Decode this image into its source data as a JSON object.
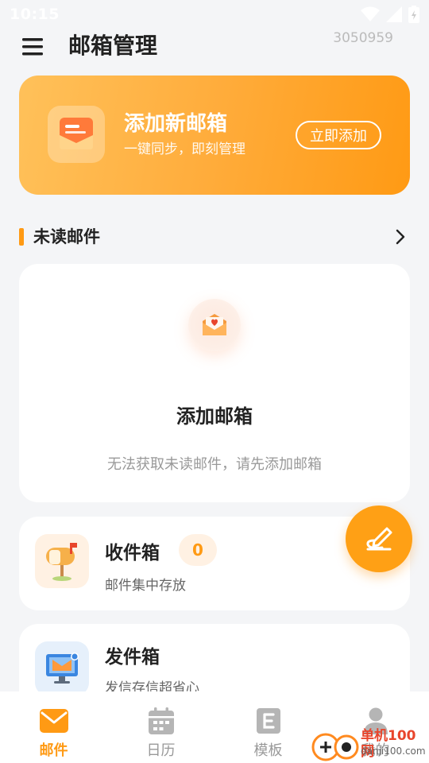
{
  "status_bar": {
    "time": "10:15"
  },
  "header": {
    "title": "邮箱管理",
    "code": "3050959"
  },
  "banner": {
    "title": "添加新邮箱",
    "subtitle": "一键同步，即刻管理",
    "button": "立即添加"
  },
  "unread_section": {
    "title": "未读邮件"
  },
  "empty_state": {
    "title": "添加邮箱",
    "description": "无法获取未读邮件，请先添加邮箱"
  },
  "inbox": {
    "title": "收件箱",
    "count": "0",
    "subtitle": "邮件集中存放"
  },
  "outbox": {
    "title": "发件箱",
    "subtitle": "发信存信超省心"
  },
  "bottom_nav": [
    {
      "label": "邮件",
      "icon": "mail-icon",
      "active": true
    },
    {
      "label": "日历",
      "icon": "calendar-icon",
      "active": false
    },
    {
      "label": "模板",
      "icon": "template-icon",
      "active": false
    },
    {
      "label": "我的",
      "icon": "profile-icon",
      "active": false
    }
  ],
  "watermark": {
    "text": "单机100网",
    "url": "danji100.com"
  },
  "colors": {
    "accent": "#ff9a14",
    "background": "#f4f5f7"
  }
}
